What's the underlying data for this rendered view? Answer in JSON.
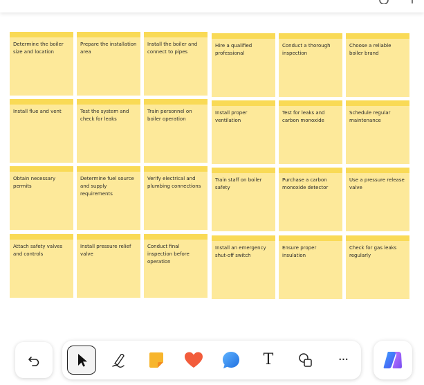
{
  "canvas": {
    "notes": [
      {
        "author": "",
        "text": "Determine the boiler size and location"
      },
      {
        "author": "",
        "text": "Prepare the installation area"
      },
      {
        "author": "",
        "text": "Install the boiler and connect to pipes"
      },
      {
        "author": "",
        "text": "Hire a qualified professional"
      },
      {
        "author": "",
        "text": "Conduct a thorough inspection"
      },
      {
        "author": "",
        "text": "Choose a reliable boiler brand"
      },
      {
        "author": "",
        "text": "Install flue and vent"
      },
      {
        "author": "",
        "text": "Test the system and check for leaks"
      },
      {
        "author": "",
        "text": "Train personnel on boiler operation"
      },
      {
        "author": "",
        "text": "Install proper ventilation"
      },
      {
        "author": "",
        "text": "Test for leaks and carbon monoxide"
      },
      {
        "author": "",
        "text": "Schedule regular maintenance"
      },
      {
        "author": "",
        "text": "Obtain necessary permits"
      },
      {
        "author": "",
        "text": "Determine fuel source and supply requirements"
      },
      {
        "author": "",
        "text": "Verify electrical and plumbing connections"
      },
      {
        "author": "",
        "text": "Train staff on boiler safety"
      },
      {
        "author": "",
        "text": "Purchase a carbon monoxide detector"
      },
      {
        "author": "",
        "text": "Use a pressure release valve"
      },
      {
        "author": "",
        "text": "Attach safety valves and controls"
      },
      {
        "author": "",
        "text": "Install pressure relief valve"
      },
      {
        "author": "",
        "text": "Conduct final inspection before operation"
      },
      {
        "author": "",
        "text": "Install an emergency shut-off switch"
      },
      {
        "author": "",
        "text": "Ensure proper insulation"
      },
      {
        "author": "",
        "text": "Check for gas leaks regularly"
      }
    ]
  },
  "toolbar": {
    "tools": [
      {
        "name": "select",
        "icon": "cursor-icon",
        "selected": true
      },
      {
        "name": "pen",
        "icon": "pen-icon",
        "selected": false
      },
      {
        "name": "sticky-note",
        "icon": "sticky-note-icon",
        "selected": false
      },
      {
        "name": "reaction",
        "icon": "heart-icon",
        "selected": false
      },
      {
        "name": "comment",
        "icon": "comment-icon",
        "selected": false
      },
      {
        "name": "text",
        "icon": "text-icon",
        "selected": false
      },
      {
        "name": "shapes",
        "icon": "shapes-icon",
        "selected": false
      },
      {
        "name": "more",
        "icon": "more-icon",
        "selected": false
      }
    ],
    "text_tool_glyph": "T",
    "more_glyph": "···"
  },
  "colors": {
    "note_body": "#fde99a",
    "note_strip": "#f9da56",
    "heart": "#f25c3b",
    "comment": "#2e8cf0",
    "sticky_icon": "#f7b52c",
    "copilot_a": "#4a6cf7",
    "copilot_b": "#9b4df0"
  }
}
